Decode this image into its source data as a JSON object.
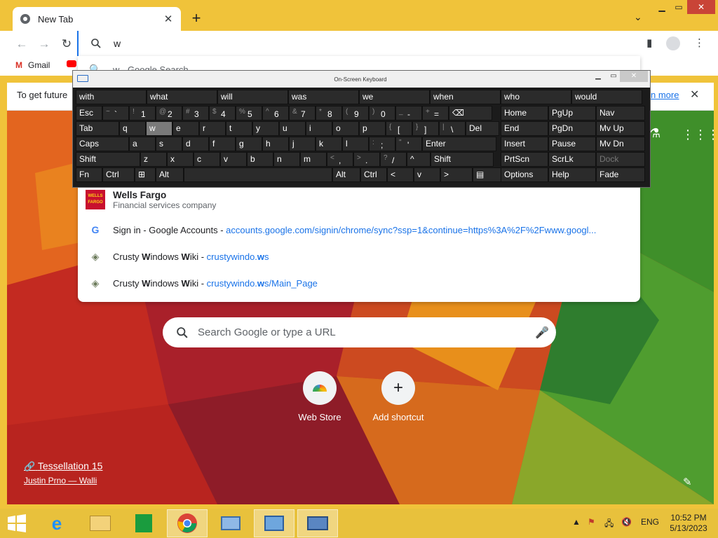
{
  "browser": {
    "tab_title": "New Tab",
    "address_text": "w",
    "bookmarks": [
      "Gmail"
    ],
    "infobar_text": "To get future",
    "infobar_link": "n more"
  },
  "suggestions": [
    {
      "prefix": "w",
      "rest": " - Google Search",
      "kind": "search-icon"
    },
    {
      "bold": "W",
      "rest": "ells Fargo",
      "sub": "Financial services company",
      "kind": "wells-fargo-logo-icon"
    },
    {
      "title": "Sign in - Google Accounts",
      "sep": " - ",
      "url": "accounts.google.com/signin/chrome/sync?ssp=1&continue=https%3A%2F%2Fwww.googl...",
      "kind": "google-g-icon"
    },
    {
      "title_pre": "Crusty ",
      "title_b1": "W",
      "title_mid": "indows ",
      "title_b2": "W",
      "title_post": "iki",
      "sep": " - ",
      "url_pre": "crustywindo.",
      "url_b": "w",
      "url_post": "s",
      "kind": "site-favicon-icon"
    },
    {
      "title_pre": "Crusty ",
      "title_b1": "W",
      "title_mid": "indows ",
      "title_b2": "W",
      "title_post": "iki",
      "sep": " - ",
      "url_pre": "crustywindo.",
      "url_b": "w",
      "url_post": "s/Main_Page",
      "kind": "site-favicon-icon"
    }
  ],
  "ntp": {
    "search_placeholder": "Search Google or type a URL",
    "shortcuts": [
      {
        "label": "Web Store",
        "icon": "web-store-icon"
      },
      {
        "label": "Add shortcut",
        "icon": "plus-icon"
      }
    ],
    "credit_title": "Tessellation 15",
    "credit_author": "Justin Prno — Walli"
  },
  "osk": {
    "title": "On-Screen Keyboard",
    "predictions": [
      "with",
      "what",
      "will",
      "was",
      "we",
      "when",
      "who",
      "would"
    ],
    "row1": [
      {
        "main": "Esc"
      },
      {
        "shift": "~",
        "main": "`"
      },
      {
        "shift": "!",
        "main": "1"
      },
      {
        "shift": "@",
        "main": "2"
      },
      {
        "shift": "#",
        "main": "3"
      },
      {
        "shift": "$",
        "main": "4"
      },
      {
        "shift": "%",
        "main": "5"
      },
      {
        "shift": "^",
        "main": "6"
      },
      {
        "shift": "&",
        "main": "7"
      },
      {
        "shift": "*",
        "main": "8"
      },
      {
        "shift": "(",
        "main": "9"
      },
      {
        "shift": ")",
        "main": "0"
      },
      {
        "shift": "_",
        "main": "-"
      },
      {
        "shift": "+",
        "main": "="
      },
      {
        "main": "⌫"
      }
    ],
    "row2": [
      "Tab",
      "q",
      "w",
      "e",
      "r",
      "t",
      "y",
      "u",
      "i",
      "o",
      "p",
      "[",
      "]",
      "\\",
      "Del"
    ],
    "row2_shift": [
      "",
      "",
      "",
      "",
      "",
      "",
      "",
      "",
      "",
      "",
      "",
      "{",
      "}",
      "|",
      ""
    ],
    "row3": [
      "Caps",
      "a",
      "s",
      "d",
      "f",
      "g",
      "h",
      "j",
      "k",
      "l",
      ";",
      "'",
      "Enter"
    ],
    "row3_shift": [
      "",
      "",
      "",
      "",
      "",
      "",
      "",
      "",
      "",
      "",
      ":",
      "\"",
      ""
    ],
    "row4": [
      "Shift",
      "z",
      "x",
      "c",
      "v",
      "b",
      "n",
      "m",
      ",",
      ".",
      "/",
      "^",
      "Shift"
    ],
    "row4_shift": [
      "",
      "",
      "",
      "",
      "",
      "",
      "",
      "",
      "<",
      ">",
      "?",
      "",
      ""
    ],
    "row5": [
      "Fn",
      "Ctrl",
      "⊞",
      "Alt",
      "",
      "Alt",
      "Ctrl",
      "<",
      "v",
      ">",
      "▤"
    ],
    "nav": [
      [
        "Home",
        "PgUp",
        "Nav"
      ],
      [
        "End",
        "PgDn",
        "Mv Up"
      ],
      [
        "Insert",
        "Pause",
        "Mv Dn"
      ],
      [
        "PrtScn",
        "ScrLk",
        "Dock"
      ],
      [
        "Options",
        "Help",
        "Fade"
      ]
    ],
    "pressed_key": "w"
  },
  "taskbar": {
    "language": "ENG",
    "time": "10:52 PM",
    "date": "5/13/2023"
  }
}
